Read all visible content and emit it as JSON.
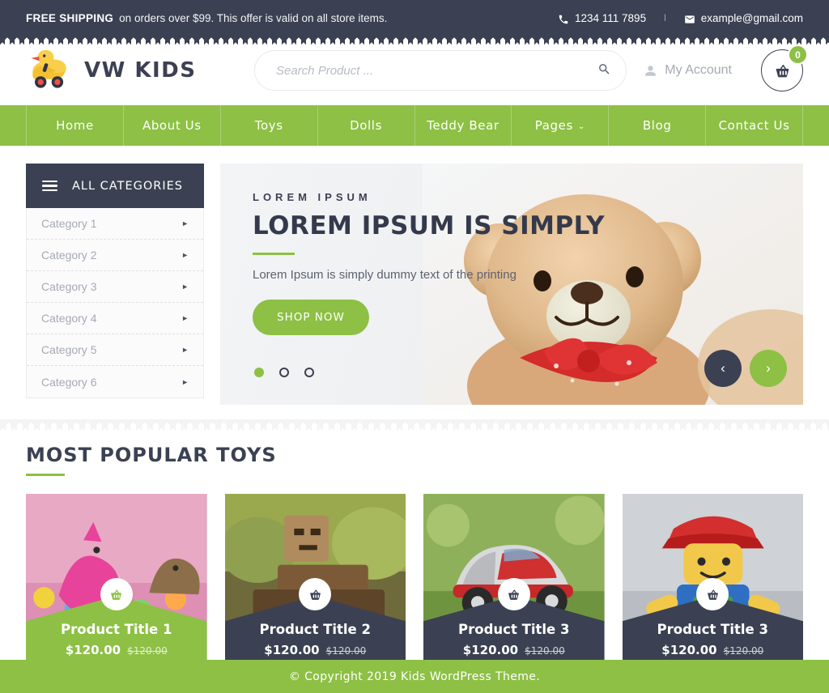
{
  "topbar": {
    "shipping_strong": "FREE SHIPPING",
    "shipping_text": "on orders over $99. This offer is valid on all store items.",
    "phone": "1234 111 7895",
    "separator": "l",
    "email": "example@gmail.com"
  },
  "header": {
    "logo_text": "VW KIDS",
    "search_placeholder": "Search Product ...",
    "search_value": "",
    "account_label": "My Account",
    "cart_count": "0"
  },
  "nav": {
    "items": [
      {
        "label": "Home",
        "has_dropdown": false
      },
      {
        "label": "About Us",
        "has_dropdown": false
      },
      {
        "label": "Toys",
        "has_dropdown": false
      },
      {
        "label": "Dolls",
        "has_dropdown": false
      },
      {
        "label": "Teddy Bear",
        "has_dropdown": false
      },
      {
        "label": "Pages",
        "has_dropdown": true,
        "chevron": "⌄"
      },
      {
        "label": "Blog",
        "has_dropdown": false
      },
      {
        "label": "Contact Us",
        "has_dropdown": false
      }
    ]
  },
  "sidebar": {
    "header_label": "ALL CATEGORIES",
    "items": [
      {
        "label": "Category 1"
      },
      {
        "label": "Category 2"
      },
      {
        "label": "Category 3"
      },
      {
        "label": "Category 4"
      },
      {
        "label": "Category 5"
      },
      {
        "label": "Category 6"
      }
    ]
  },
  "hero": {
    "kicker": "LOREM IPSUM",
    "title": "LOREM IPSUM IS SIMPLY",
    "description": "Lorem Ipsum is simply dummy text of the printing",
    "button_label": "SHOP NOW",
    "slides": 3,
    "active_slide": 1,
    "prev_label": "‹",
    "next_label": "›"
  },
  "products": {
    "section_title": "MOST POPULAR TOYS",
    "items": [
      {
        "title": "Product Title 1",
        "price": "$120.00",
        "old_price": "$120.00",
        "accent": "green",
        "image": "dinosaur-toys"
      },
      {
        "title": "Product Title 2",
        "price": "$120.00",
        "old_price": "$120.00",
        "accent": "dark",
        "image": "cardboard-robot-train"
      },
      {
        "title": "Product Title 3",
        "price": "$120.00",
        "old_price": "$120.00",
        "accent": "dark",
        "image": "toy-car-grass"
      },
      {
        "title": "Product Title 3",
        "price": "$120.00",
        "old_price": "$120.00",
        "accent": "dark",
        "image": "lego-figure"
      }
    ]
  },
  "footer": {
    "copyright": "© Copyright 2019 Kids WordPress Theme."
  },
  "colors": {
    "green": "#8dc044",
    "dark": "#3b4152",
    "muted": "#a6aab5"
  }
}
